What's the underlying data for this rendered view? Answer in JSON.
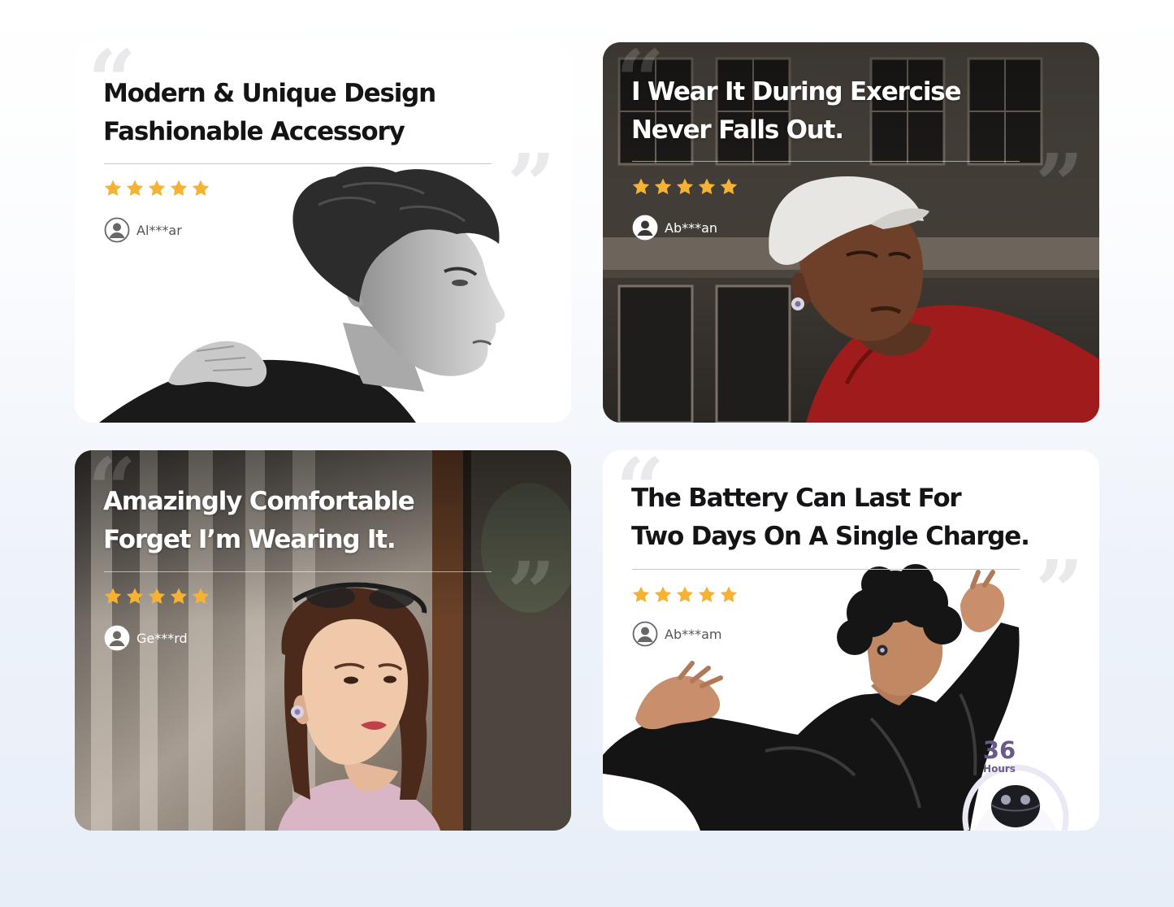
{
  "accent": {
    "star": "#f5b233",
    "badge": "#6a5a8c"
  },
  "reviews": [
    {
      "headline": [
        "Modern & Unique Design",
        "Fashionable Accessory"
      ],
      "rating": 5,
      "reviewer": "Al***ar",
      "image": "black-and-white portrait of a man wearing an open-ear earbud"
    },
    {
      "headline": [
        "I Wear It During Exercise",
        "Never Falls Out."
      ],
      "rating": 5,
      "reviewer": "Ab***an",
      "image": "man in white cap and red hoodie wearing an earbud in front of a building"
    },
    {
      "headline": [
        "Amazingly Comfortable",
        "Forget I’m Wearing It."
      ],
      "rating": 5,
      "reviewer": "Ge***rd",
      "image": "woman with sunglasses on her head wearing an earbud beside a curtained window"
    },
    {
      "headline": [
        "The Battery Can Last For",
        "Two Days On A Single Charge."
      ],
      "rating": 5,
      "reviewer": "Ab***am",
      "image": "man dancing in a black shiny jacket wearing an earbud",
      "battery_badge": {
        "value": "36",
        "unit": "Hours"
      }
    }
  ]
}
